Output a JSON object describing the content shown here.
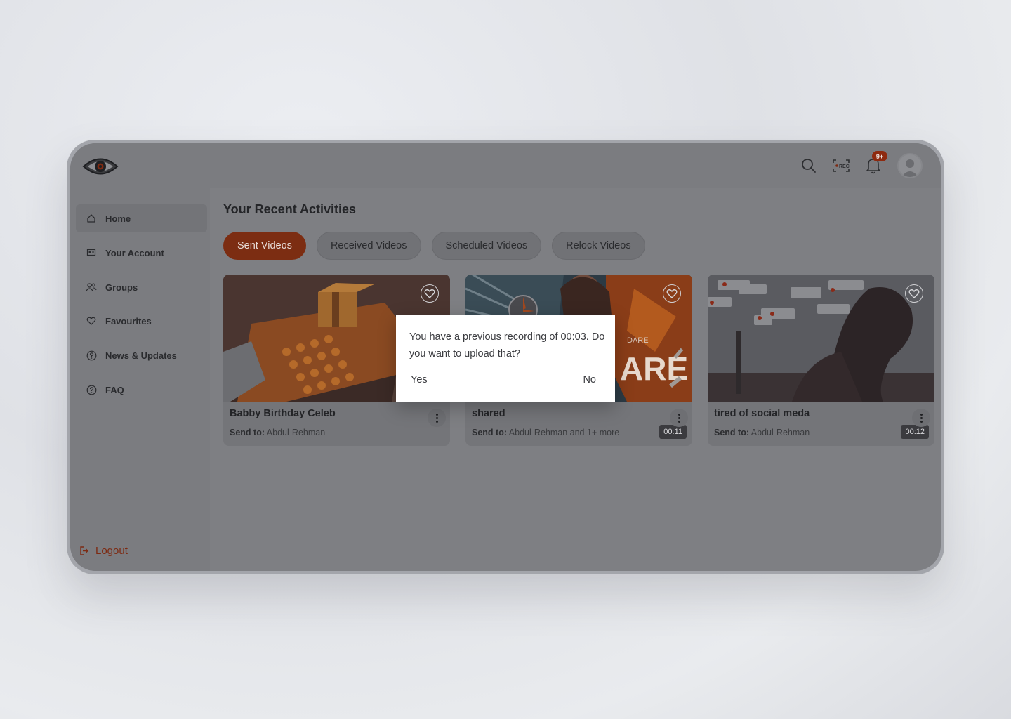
{
  "sidebar": {
    "items": [
      {
        "label": "Home",
        "icon": "home-icon",
        "active": true
      },
      {
        "label": "Your Account",
        "icon": "account-icon"
      },
      {
        "label": "Groups",
        "icon": "groups-icon"
      },
      {
        "label": "Favourites",
        "icon": "heart-icon"
      },
      {
        "label": "News & Updates",
        "icon": "help-circle-icon"
      },
      {
        "label": "FAQ",
        "icon": "help-circle-icon"
      }
    ],
    "logout_label": "Logout"
  },
  "header": {
    "notification_badge": "9+",
    "rec_label": "REC"
  },
  "main": {
    "title": "Your Recent Activities",
    "tabs": [
      {
        "label": "Sent Videos",
        "active": true
      },
      {
        "label": "Received Videos"
      },
      {
        "label": "Scheduled Videos"
      },
      {
        "label": "Relock Videos"
      }
    ],
    "cards": [
      {
        "title": "Babby Birthday Celeb",
        "send_to_label": "Send to:",
        "recipients": "Abdul-Rehman",
        "duration": ""
      },
      {
        "title": "shared",
        "send_to_label": "Send to:",
        "recipients": "Abdul-Rehman and 1+ more",
        "duration": "00:11",
        "thumb_text_small": "DARE",
        "thumb_text_big": "ARE"
      },
      {
        "title": "tired of social meda",
        "send_to_label": "Send to:",
        "recipients": "Abdul-Rehman",
        "duration": "00:12"
      }
    ]
  },
  "dialog": {
    "message": "You have a previous recording of 00:03. Do you want to upload that?",
    "yes_label": "Yes",
    "no_label": "No"
  },
  "colors": {
    "accent": "#7c2d12",
    "overlay_gray": "#7e7f83",
    "dialog_bg": "#ffffff"
  }
}
